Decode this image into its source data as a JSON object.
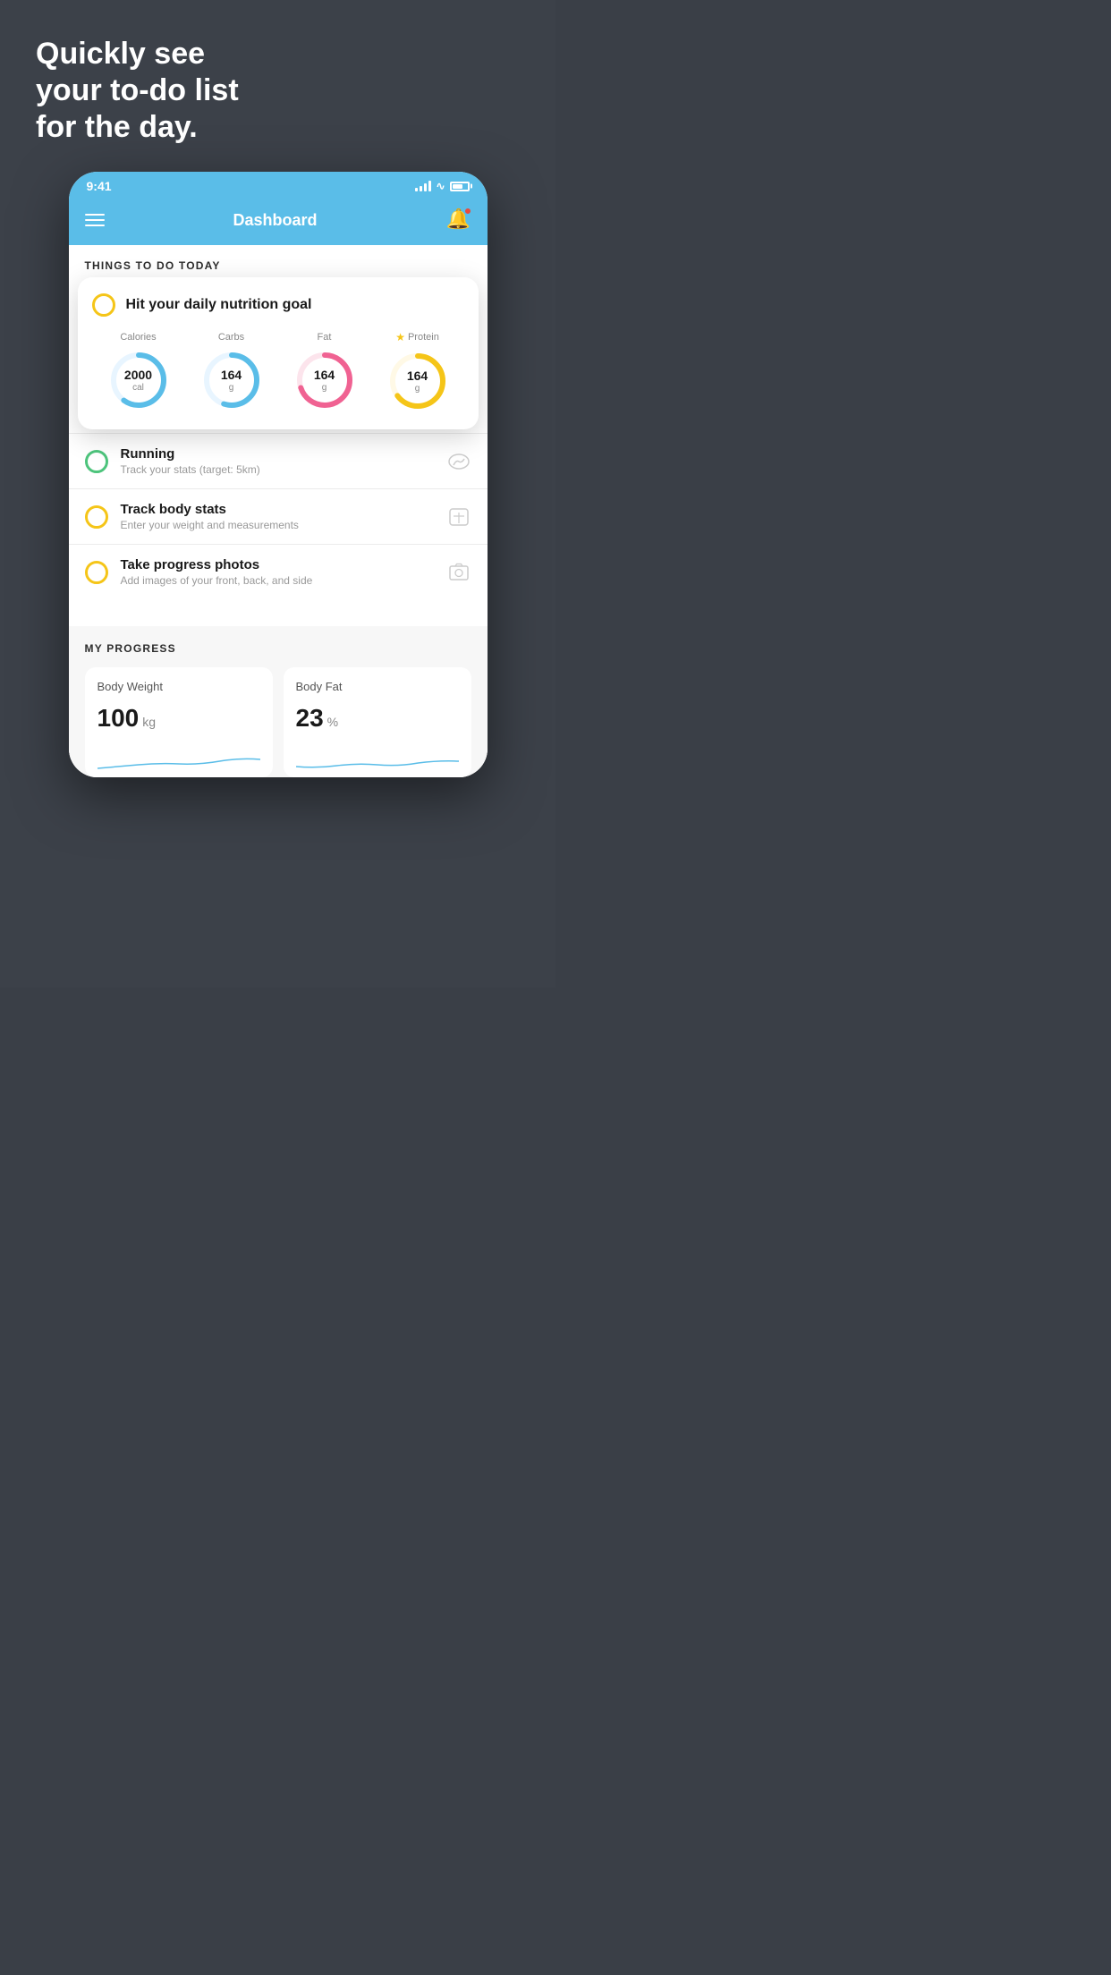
{
  "page": {
    "bg_color": "#3c4149"
  },
  "hero": {
    "line1": "Quickly see",
    "line2": "your to-do list",
    "line3": "for the day."
  },
  "status_bar": {
    "time": "9:41"
  },
  "header": {
    "title": "Dashboard"
  },
  "sections": {
    "things_today": "THINGS TO DO TODAY",
    "my_progress": "MY PROGRESS"
  },
  "nutrition_card": {
    "title": "Hit your daily nutrition goal",
    "items": [
      {
        "label": "Calories",
        "value": "2000",
        "unit": "cal",
        "color": "#5abde8",
        "track_color": "#e8f5ff",
        "percent": 60
      },
      {
        "label": "Carbs",
        "value": "164",
        "unit": "g",
        "color": "#5abde8",
        "track_color": "#e8f5ff",
        "percent": 55
      },
      {
        "label": "Fat",
        "value": "164",
        "unit": "g",
        "color": "#f06292",
        "track_color": "#fce4ec",
        "percent": 70
      },
      {
        "label": "Protein",
        "value": "164",
        "unit": "g",
        "color": "#f5c518",
        "track_color": "#fff9e6",
        "percent": 65,
        "starred": true
      }
    ]
  },
  "todo_items": [
    {
      "id": "running",
      "title": "Running",
      "subtitle": "Track your stats (target: 5km)",
      "checkbox_color": "#4dc47c",
      "icon": "👟"
    },
    {
      "id": "track_body",
      "title": "Track body stats",
      "subtitle": "Enter your weight and measurements",
      "checkbox_color": "#f5c518",
      "icon": "⊡"
    },
    {
      "id": "progress_photos",
      "title": "Take progress photos",
      "subtitle": "Add images of your front, back, and side",
      "checkbox_color": "#f5c518",
      "icon": "🖼"
    }
  ],
  "progress": {
    "body_weight": {
      "title": "Body Weight",
      "value": "100",
      "unit": "kg"
    },
    "body_fat": {
      "title": "Body Fat",
      "value": "23",
      "unit": "%"
    }
  }
}
